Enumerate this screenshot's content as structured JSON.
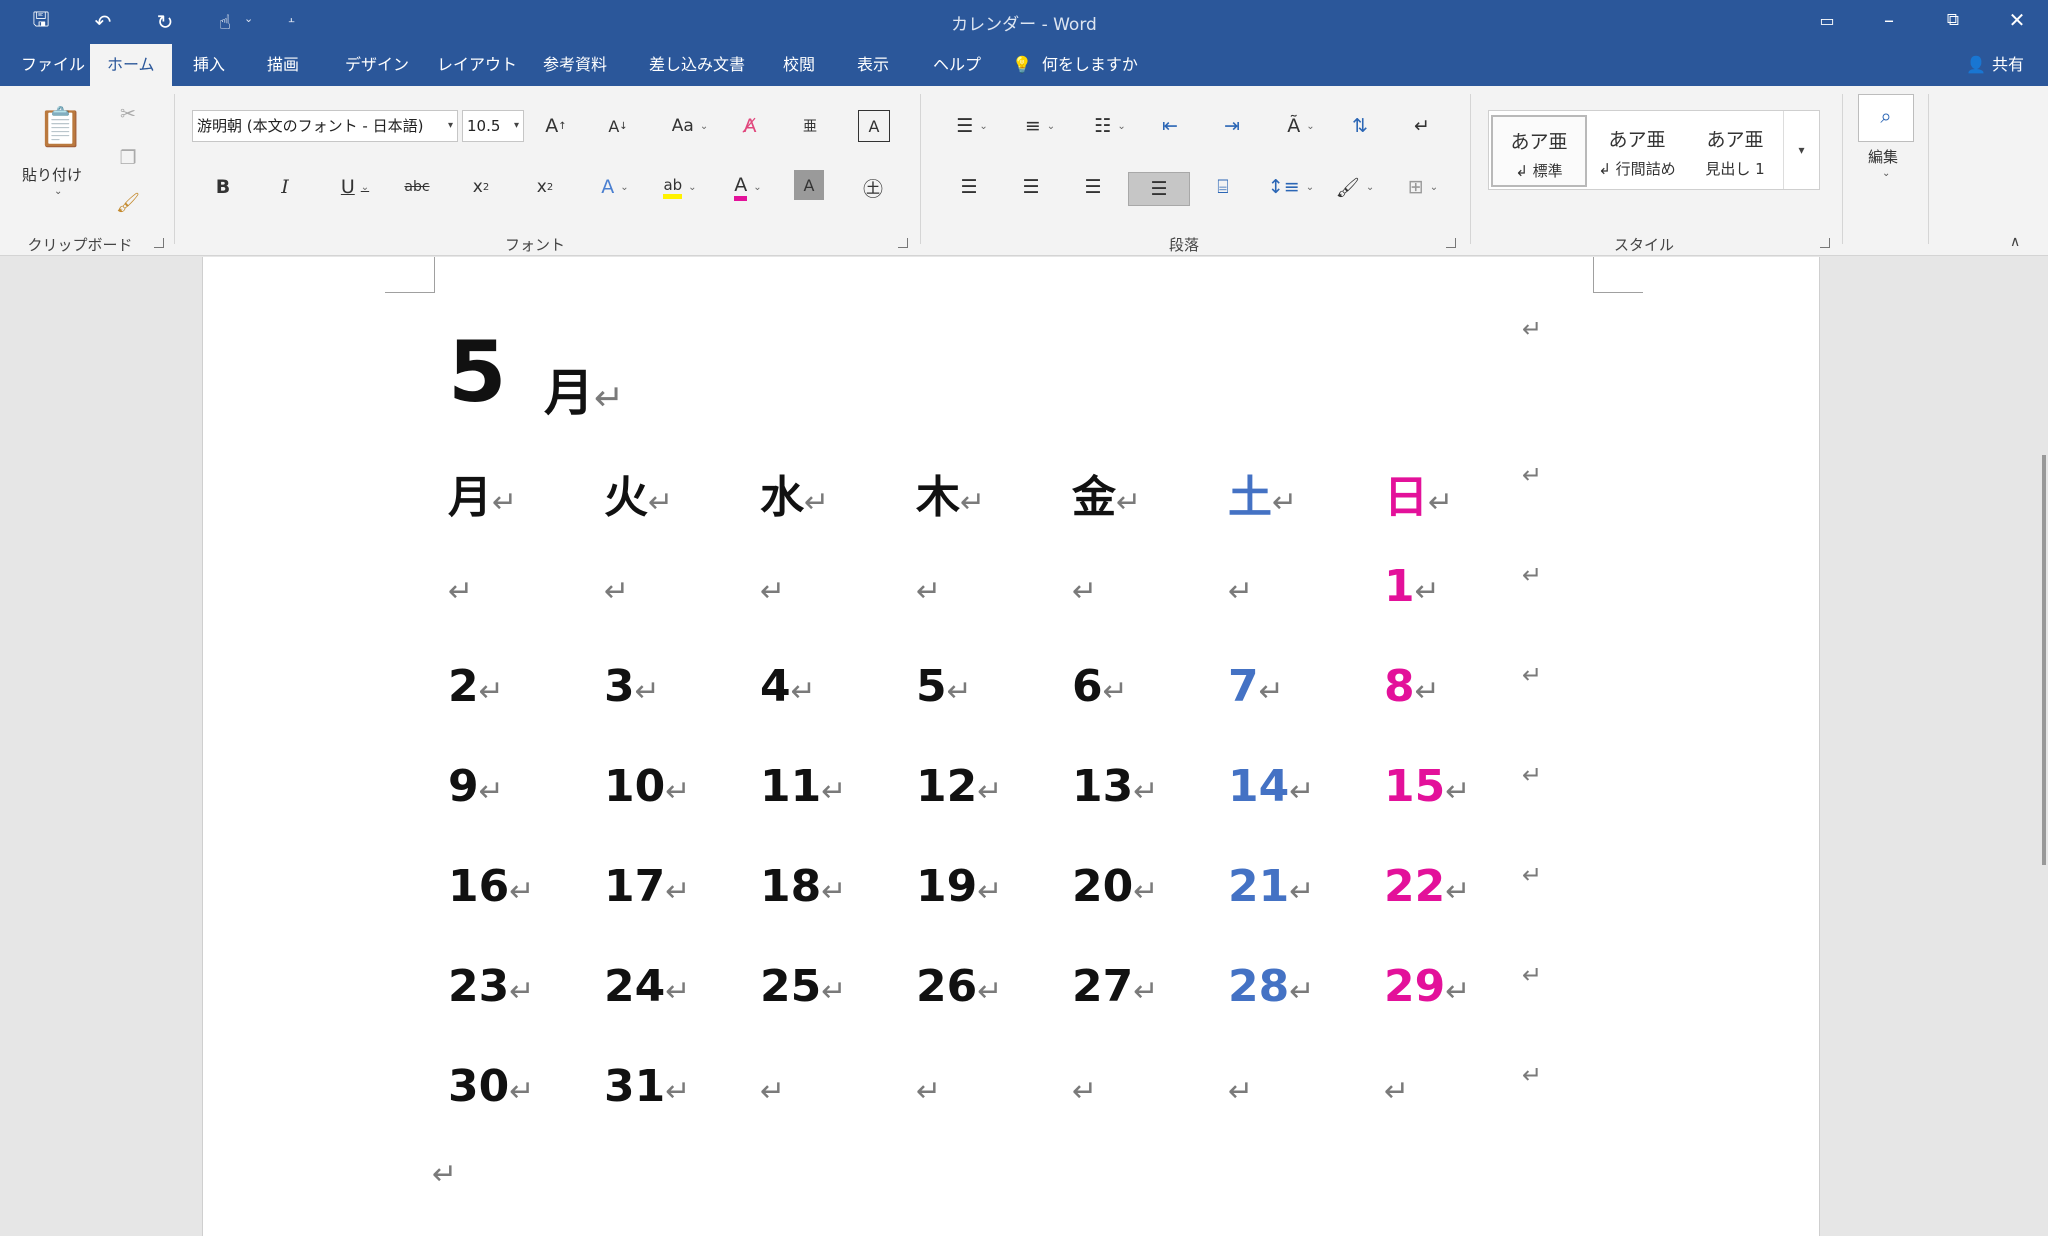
{
  "titlebar": {
    "doc_title": "カレンダー  -  Word"
  },
  "tabs": [
    "ファイル",
    "ホーム",
    "挿入",
    "描画",
    "デザイン",
    "レイアウト",
    "参考資料",
    "差し込み文書",
    "校閲",
    "表示",
    "ヘルプ"
  ],
  "active_tab": "ホーム",
  "tell_me": "何をしますか",
  "share": "共有",
  "ribbon": {
    "clipboard": {
      "paste_label": "貼り付け",
      "group_label": "クリップボード"
    },
    "font": {
      "font_name": "游明朝 (本文のフォント - 日本語)",
      "font_size": "10.5",
      "group_label": "フォント"
    },
    "paragraph": {
      "group_label": "段落"
    },
    "styles": {
      "group_label": "スタイル",
      "items": [
        {
          "sample": "あア亜",
          "name": "↲ 標準"
        },
        {
          "sample": "あア亜",
          "name": "↲ 行間詰め"
        },
        {
          "sample": "あア亜",
          "name": "見出し 1"
        }
      ]
    },
    "editing": {
      "label": "編集"
    }
  },
  "calendar": {
    "month_number": "5",
    "month_kanji": "月",
    "return_mark": "↵",
    "weekdays": [
      "月",
      "火",
      "水",
      "木",
      "金",
      "土",
      "日"
    ],
    "weeks": [
      [
        "",
        "",
        "",
        "",
        "",
        "",
        "1"
      ],
      [
        "2",
        "3",
        "4",
        "5",
        "6",
        "7",
        "8"
      ],
      [
        "9",
        "10",
        "11",
        "12",
        "13",
        "14",
        "15"
      ],
      [
        "16",
        "17",
        "18",
        "19",
        "20",
        "21",
        "22"
      ],
      [
        "23",
        "24",
        "25",
        "26",
        "27",
        "28",
        "29"
      ],
      [
        "30",
        "31",
        "",
        "",
        "",
        "",
        ""
      ]
    ],
    "colors": {
      "weekday": "#111111",
      "saturday": "#4472c4",
      "sunday": "#e3119a"
    }
  }
}
